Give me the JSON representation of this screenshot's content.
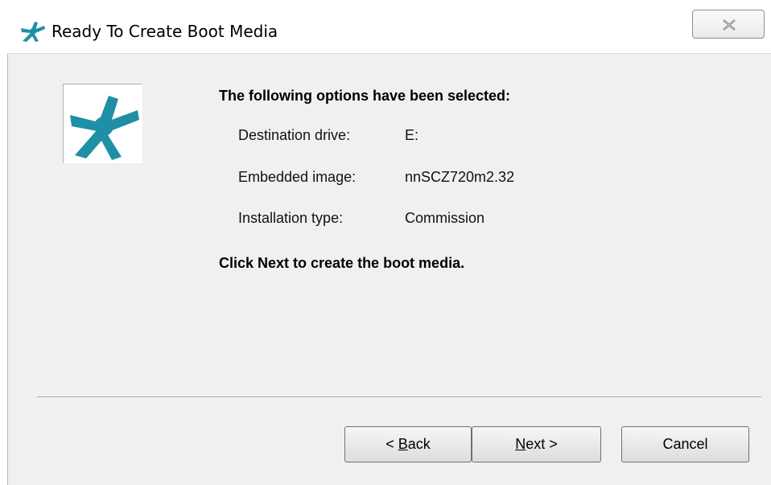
{
  "window": {
    "title": "Ready To Create Boot Media",
    "close_icon": "close-x-icon",
    "app_icon": "asterisk-logo-icon",
    "accent_color": "#1f8fa6"
  },
  "content": {
    "heading": "The following options have been selected:",
    "options": [
      {
        "label": "Destination drive:",
        "value": "E:"
      },
      {
        "label": "Embedded image:",
        "value": "nnSCZ720m2.32"
      },
      {
        "label": "Installation type:",
        "value": "Commission"
      }
    ],
    "instruction": "Click Next to create the boot media."
  },
  "buttons": {
    "back": {
      "prefix": "< ",
      "accel": "B",
      "rest": "ack"
    },
    "next": {
      "accel": "N",
      "rest": "ext >"
    },
    "cancel": {
      "label": "Cancel"
    }
  }
}
